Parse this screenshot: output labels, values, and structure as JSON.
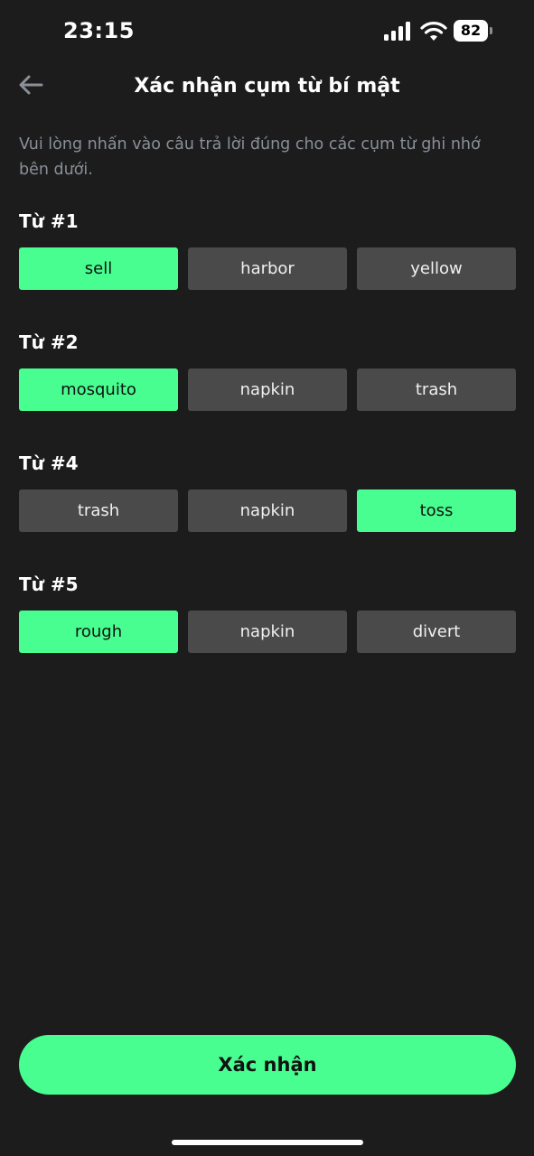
{
  "status_bar": {
    "time": "23:15",
    "battery": "82",
    "icons": [
      "signal-icon",
      "wifi-icon",
      "battery-icon"
    ]
  },
  "header": {
    "back_icon": "arrow-left-icon",
    "title": "Xác nhận cụm từ bí mật"
  },
  "instructions": "Vui lòng nhấn vào câu trả lời đúng cho các cụm từ ghi nhớ bên dưới.",
  "questions": [
    {
      "label": "Từ #1",
      "options": [
        "sell",
        "harbor",
        "yellow"
      ],
      "selected_index": 0
    },
    {
      "label": "Từ #2",
      "options": [
        "mosquito",
        "napkin",
        "trash"
      ],
      "selected_index": 0
    },
    {
      "label": "Từ #4",
      "options": [
        "trash",
        "napkin",
        "toss"
      ],
      "selected_index": 2
    },
    {
      "label": "Từ #5",
      "options": [
        "rough",
        "napkin",
        "divert"
      ],
      "selected_index": 0
    }
  ],
  "confirm_button": {
    "label": "Xác nhận"
  },
  "colors": {
    "background": "#1c1c1c",
    "accent": "#48fe90",
    "option_default": "#4a4a4a",
    "muted_text": "#8a8f98"
  }
}
